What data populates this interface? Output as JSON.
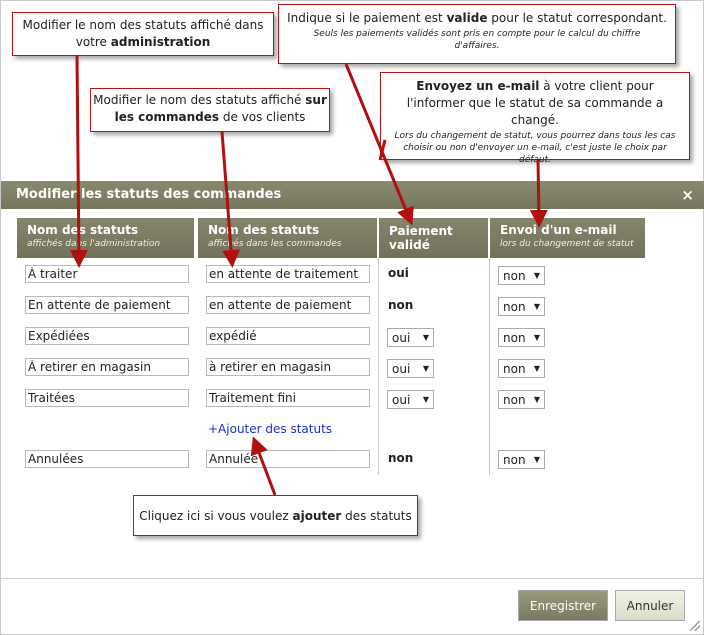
{
  "dialog": {
    "title": "Modifier les statuts des commandes",
    "close_glyph": "×"
  },
  "columns": [
    {
      "title": "Nom des statuts",
      "subtitle": "affichés dans l'administration"
    },
    {
      "title": "Nom des statuts",
      "subtitle": "affichés dans les commandes"
    },
    {
      "title": "Paiement validé",
      "subtitle": ""
    },
    {
      "title": "Envoi d'un e-mail",
      "subtitle": "lors du changement de statut"
    }
  ],
  "rows": [
    {
      "admin": "À traiter",
      "order": "en attente de traitement",
      "payment": "oui",
      "payment_type": "text",
      "email": "non"
    },
    {
      "admin": "En attente de paiement",
      "order": "en attente de paiement",
      "payment": "non",
      "payment_type": "text",
      "email": "non"
    },
    {
      "admin": "Expédiées",
      "order": "expédié",
      "payment": "oui",
      "payment_type": "select",
      "email": "non"
    },
    {
      "admin": "À retirer en magasin",
      "order": "à retirer en magasin",
      "payment": "oui",
      "payment_type": "select",
      "email": "non"
    },
    {
      "admin": "Traitées",
      "order": "Traitement fini",
      "payment": "oui",
      "payment_type": "select",
      "email": "non"
    }
  ],
  "add_link": "+Ajouter des statuts",
  "last_row": {
    "admin": "Annulées",
    "order": "Annulée",
    "payment": "non",
    "email": "non"
  },
  "buttons": {
    "save": "Enregistrer",
    "cancel": "Annuler"
  },
  "callouts": {
    "admin_name": {
      "before": "Modifier le nom des statuts affiché dans votre ",
      "bold": "administration"
    },
    "order_name": {
      "before": "Modifier le nom des statuts affiché ",
      "bold": "sur les commandes",
      "after": " de vos clients"
    },
    "payment": {
      "before": "Indique si le paiement est ",
      "bold": "valide",
      "after": " pour le statut correspondant.",
      "small": "Seuls les paiements validés sont pris en compte pour le calcul du chiffre d'affaires."
    },
    "email": {
      "bold": "Envoyez un e-mail",
      "after": " à votre client pour l'informer que le statut de sa commande a changé.",
      "small": "Lors du changement de statut, vous pourrez dans tous les cas choisir ou non d'envoyer un e-mail, c'est juste le choix par défaut."
    },
    "add": {
      "before": "Cliquez ici si vous voulez ",
      "bold": "ajouter",
      "after": " des statuts"
    }
  },
  "colors": {
    "header": "#7f7f65",
    "callout_border": "#b91414",
    "arrow": "#b01010",
    "link": "#1a33cc"
  }
}
